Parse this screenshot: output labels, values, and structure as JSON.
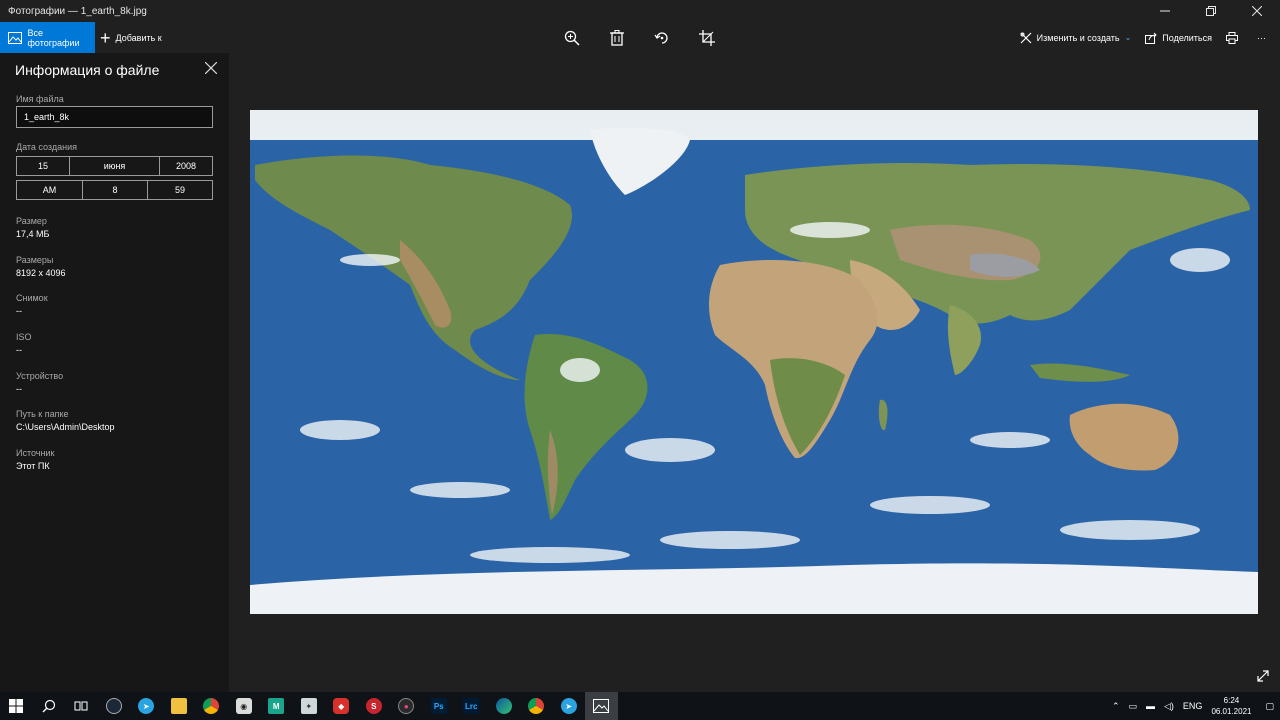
{
  "window": {
    "title": "Фотографии — 1_earth_8k.jpg"
  },
  "cmdbar": {
    "all_photos": "Все фотографии",
    "add_to": "Добавить к",
    "edit_create": "Изменить и создать",
    "share": "Поделиться",
    "more": "···",
    "accent_color": "#0078d7"
  },
  "panel": {
    "title": "Информация о файле",
    "filename_label": "Имя файла",
    "filename_value": "1_earth_8k",
    "date_label": "Дата создания",
    "date_day": "15",
    "date_month": "июня",
    "date_year": "2008",
    "time_ampm": "AM",
    "time_hour": "8",
    "time_minute": "59",
    "size_label": "Размер",
    "size_value": "17,4 МБ",
    "dimensions_label": "Размеры",
    "dimensions_value": "8192 x 4096",
    "shot_label": "Снимок",
    "shot_value": "--",
    "iso_label": "ISO",
    "iso_value": "--",
    "device_label": "Устройство",
    "device_value": "--",
    "folder_label": "Путь к папке",
    "folder_value": "C:\\Users\\Admin\\Desktop",
    "source_label": "Источник",
    "source_value": "Этот ПК"
  },
  "taskbar": {
    "ps_label": "Ps",
    "lrc_label": "Lrc",
    "m_label": "M",
    "lang": "ENG",
    "time": "6:24",
    "date": "06.01.2021"
  }
}
